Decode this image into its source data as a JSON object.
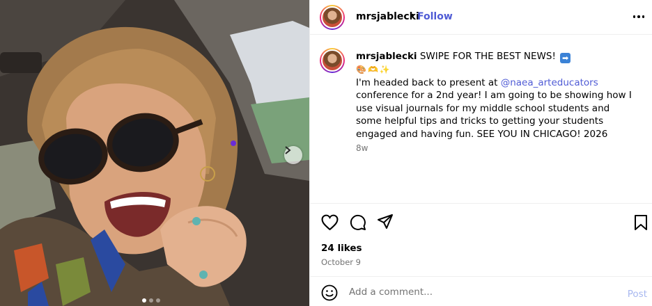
{
  "post": {
    "username": "mrsjablecki",
    "separator": "•",
    "follow_label": "Follow",
    "caption_headline": "SWIPE FOR THE BEST NEWS!",
    "caption_arrow": "➡",
    "caption_emojis": "🎨🫶✨",
    "caption_text_1": "I'm headed back to present at ",
    "mention": "@naea_arteducators",
    "caption_text_2": " conference for a 2nd year! I am going to be showing how I use visual journals for my middle school students and some helpful tips and tricks to getting your students engaged and having fun. SEE YOU IN CHICAGO! 2026",
    "time_ago": "8w",
    "likes": "24 likes",
    "date": "October 9"
  },
  "comment": {
    "placeholder": "Add a comment...",
    "post_label": "Post"
  },
  "icons": {
    "like": "heart-icon",
    "comment": "comment-icon",
    "share": "paper-plane-icon",
    "save": "bookmark-icon",
    "emoji": "smiley-icon",
    "more": "more-options-icon",
    "next": "chevron-right-icon"
  },
  "colors": {
    "link": "#4f5bd5",
    "muted": "#737373",
    "post_disabled": "#a8b8f0"
  },
  "carousel": {
    "total_slides": 3,
    "active_slide": 1
  }
}
